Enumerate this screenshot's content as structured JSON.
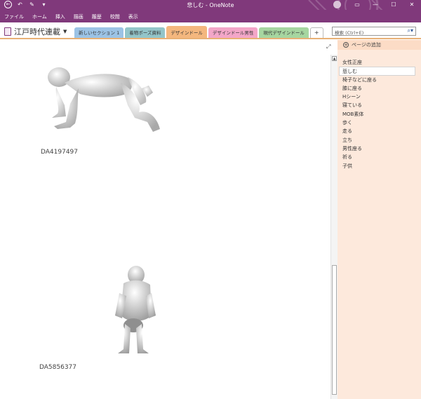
{
  "window": {
    "title": "悲しむ - OneNote",
    "controls": [
      "?",
      "▭",
      "—",
      "☐",
      "✕"
    ]
  },
  "quick_access": [
    "←",
    "↶",
    "✎",
    "▾"
  ],
  "ribbon": {
    "tabs": [
      "ファイル",
      "ホーム",
      "挿入",
      "描画",
      "履歴",
      "校閲",
      "表示"
    ]
  },
  "notebook": {
    "name": "江戸時代連載",
    "sections": [
      {
        "label": "新しいセクション 1",
        "color": "#9cc3e5"
      },
      {
        "label": "着物ポーズ資料",
        "color": "#93c5c9"
      },
      {
        "label": "デザインドール",
        "color": "#f4b77e",
        "active": true
      },
      {
        "label": "デザインドール男性",
        "color": "#f3a6c8"
      },
      {
        "label": "現代デザインドール",
        "color": "#a6d6a0"
      }
    ],
    "add_section_label": "+"
  },
  "search": {
    "placeholder": "検索 (Ctrl+E)",
    "icon": "magnifier-icon"
  },
  "page_content": {
    "captions": [
      "DA4197497",
      "DA5856377"
    ]
  },
  "page_list": {
    "add_page_label": "ページの追加",
    "pages": [
      "女性正座",
      "悲しむ",
      "椅子などに座る",
      "膝に座る",
      "Hシーン",
      "寝ている",
      "MOB素体",
      "歩く",
      "走る",
      "立ち",
      "男性座る",
      "祈る",
      "子供"
    ],
    "selected_index": 1
  },
  "colors": {
    "titlebar": "#80397b",
    "section_underline": "#e8b176",
    "page_list_bg": "#fde9dc"
  }
}
